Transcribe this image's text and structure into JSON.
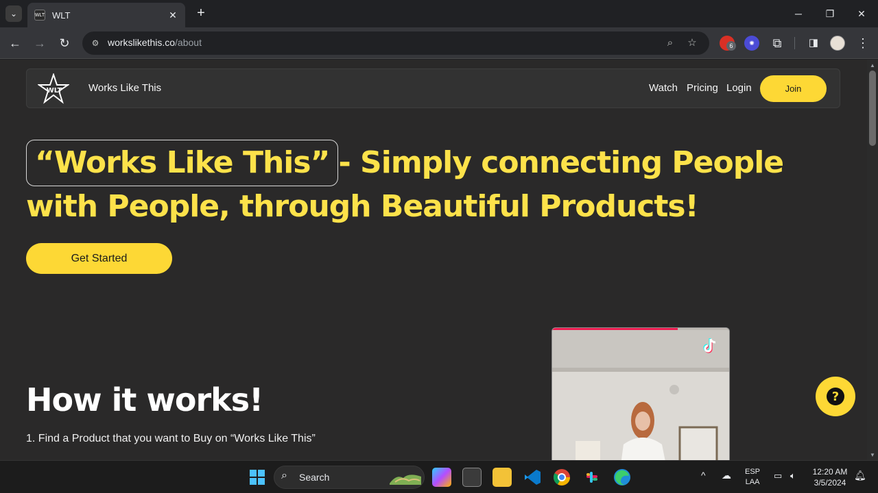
{
  "browser": {
    "tab_title": "WLT",
    "tab_favicon_text": "WLT",
    "url_host": "workslikethis.co",
    "url_path": "/about",
    "extension_badge": "6"
  },
  "navbar": {
    "logo_text": "WLT",
    "brand": "Works Like This",
    "links": [
      "Watch",
      "Pricing",
      "Login"
    ],
    "join_label": "Join"
  },
  "hero": {
    "quote": "“Works Like This”",
    "headline_rest": "- Simply connecting People with People, through Beautiful Products!",
    "cta_label": "Get Started"
  },
  "how_it_works": {
    "title": "How it works!",
    "step1": "1. Find a Product that you want to Buy on “Works Like This”"
  },
  "video": {
    "progress": 0.71,
    "progress_color": "#ee1d52"
  },
  "help": {
    "label": "?"
  },
  "taskbar": {
    "search_label": "Search",
    "lang": "ESP",
    "lang_region": "LAA",
    "time": "12:20 AM",
    "date": "3/5/2024"
  },
  "colors": {
    "accent": "#fdd835",
    "headline": "#fde24a",
    "page_bg": "#2a2929"
  }
}
